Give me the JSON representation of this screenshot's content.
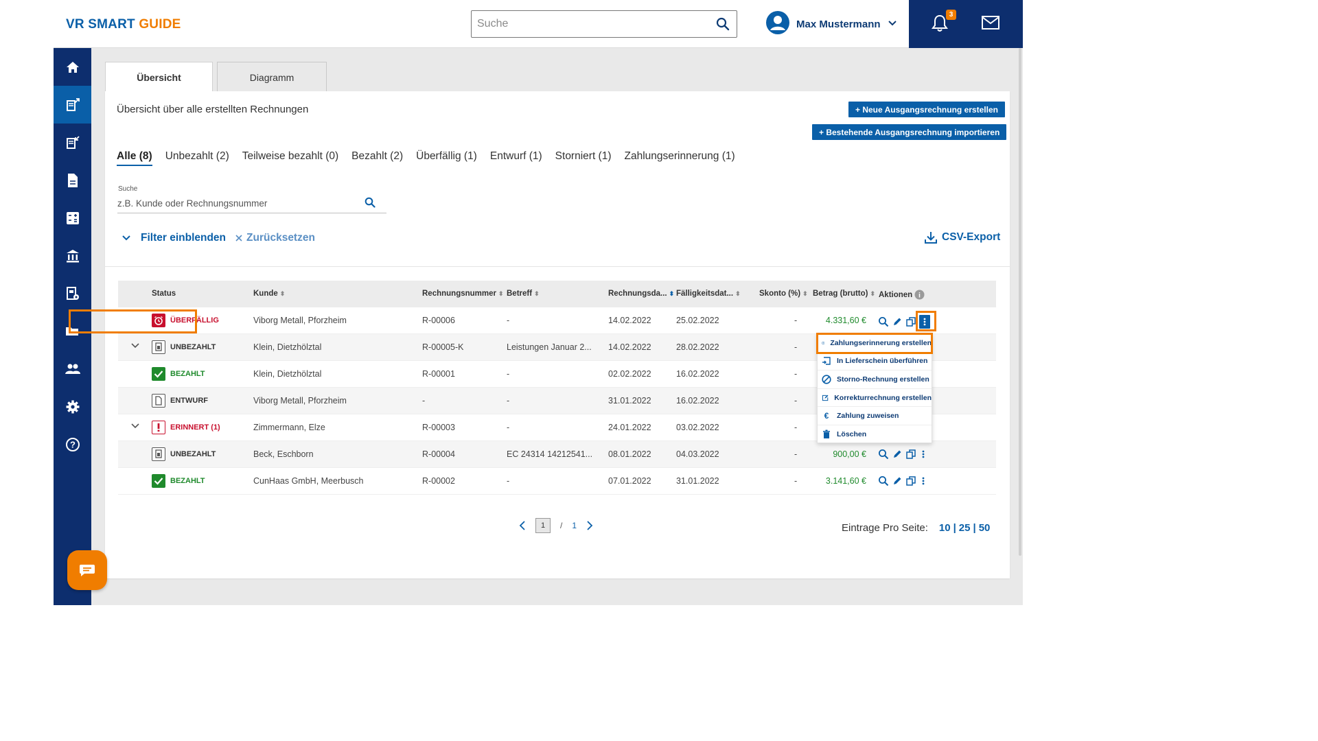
{
  "header": {
    "logo_part1": "VR SMART ",
    "logo_part2": "GUIDE",
    "search_placeholder": "Suche",
    "user_name": "Max Mustermann",
    "notification_count": "3"
  },
  "tabs": [
    {
      "label": "Übersicht"
    },
    {
      "label": "Diagramm"
    }
  ],
  "panel": {
    "title": "Übersicht über alle erstellten Rechnungen",
    "new_button": "+ Neue Ausgangsrechnung erstellen",
    "import_button": "+ Bestehende Ausgangsrechnung importieren",
    "filter_tabs": [
      "Alle (8)",
      "Unbezahlt (2)",
      "Teilweise bezahlt (0)",
      "Bezahlt (2)",
      "Überfällig (1)",
      "Entwurf (1)",
      "Storniert (1)",
      "Zahlungserinnerung (1)"
    ],
    "search_label": "Suche",
    "search_placeholder": "z.B. Kunde oder Rechnungsnummer",
    "filter_toggle": "Filter einblenden",
    "reset": "Zurücksetzen",
    "csv_export": "CSV-Export"
  },
  "table": {
    "headers": {
      "status": "Status",
      "kunde": "Kunde",
      "nummer": "Rechnungsnummer",
      "betreff": "Betreff",
      "rdatum": "Rechnungsda...",
      "fdatum": "Fälligkeitsdat...",
      "skonto": "Skonto (%)",
      "betrag": "Betrag (brutto)",
      "aktionen": "Aktionen"
    },
    "rows": [
      {
        "status": "ÜBERFÄLLIG",
        "kunde": "Viborg Metall, Pforzheim",
        "nummer": "R-00006",
        "betreff": "-",
        "rdatum": "14.02.2022",
        "fdatum": "25.02.2022",
        "skonto": "-",
        "betrag": "4.331,60 €"
      },
      {
        "status": "UNBEZAHLT",
        "kunde": "Klein, Dietzhölztal",
        "nummer": "R-00005-K",
        "betreff": "Leistungen Januar 2...",
        "rdatum": "14.02.2022",
        "fdatum": "28.02.2022",
        "skonto": "-",
        "betrag": ""
      },
      {
        "status": "BEZAHLT",
        "kunde": "Klein, Dietzhölztal",
        "nummer": "R-00001",
        "betreff": "-",
        "rdatum": "02.02.2022",
        "fdatum": "16.02.2022",
        "skonto": "-",
        "betrag": ""
      },
      {
        "status": "ENTWURF",
        "kunde": "Viborg Metall, Pforzheim",
        "nummer": "-",
        "betreff": "-",
        "rdatum": "31.01.2022",
        "fdatum": "16.02.2022",
        "skonto": "-",
        "betrag": ""
      },
      {
        "status": "ERINNERT (1)",
        "kunde": "Zimmermann, Elze",
        "nummer": "R-00003",
        "betreff": "-",
        "rdatum": "24.01.2022",
        "fdatum": "03.02.2022",
        "skonto": "-",
        "betrag": ""
      },
      {
        "status": "UNBEZAHLT",
        "kunde": "Beck, Eschborn",
        "nummer": "R-00004",
        "betreff": "EC 24314 14212541...",
        "rdatum": "08.01.2022",
        "fdatum": "04.03.2022",
        "skonto": "-",
        "betrag": "900,00 €"
      },
      {
        "status": "BEZAHLT",
        "kunde": "CunHaas GmbH, Meerbusch",
        "nummer": "R-00002",
        "betreff": "-",
        "rdatum": "07.01.2022",
        "fdatum": "31.01.2022",
        "skonto": "-",
        "betrag": "3.141,60 €"
      }
    ]
  },
  "menu": {
    "items": [
      "Zahlungserinnerung erstellen",
      "In Lieferschein überführen",
      "Storno-Rechnung erstellen",
      "Korrekturrechnung erstellen",
      "Zahlung zuweisen",
      "Löschen"
    ]
  },
  "pagination": {
    "current": "1",
    "separator": "/",
    "total": "1",
    "per_page_label": "Eintrage Pro Seite:",
    "options": [
      "10",
      "25",
      "50"
    ]
  },
  "colors": {
    "brand_blue": "#0a5fa8",
    "navy": "#0d2e6e",
    "accent_orange": "#f07d00",
    "overdue_red": "#c8102e",
    "paid_green": "#1f8a2c"
  }
}
